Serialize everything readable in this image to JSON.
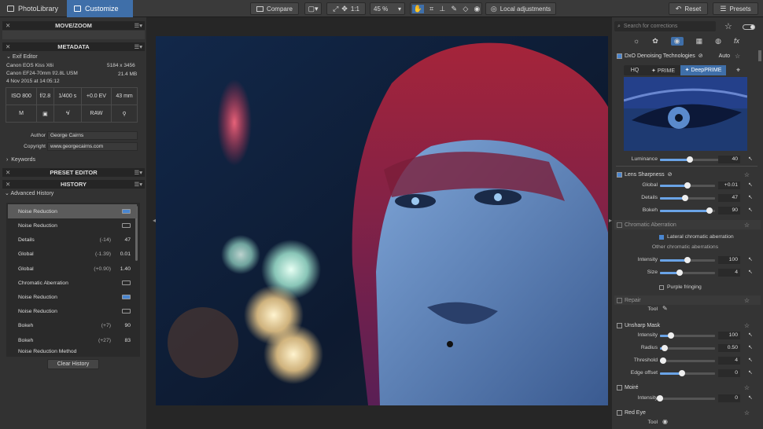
{
  "top": {
    "photolibrary": "PhotoLibrary",
    "customize": "Customize",
    "compare": "Compare",
    "ratio": "1:1",
    "zoom": "45 %",
    "local": "Local adjustments",
    "reset": "Reset",
    "presets": "Presets"
  },
  "left": {
    "move_zoom": "MOVE/ZOOM",
    "metadata": "METADATA",
    "exif_editor": "Exif Editor",
    "camera": "Canon EOS Kiss X6i",
    "dims": "5184 x 3456",
    "lens": "Canon EF24-70mm f/2.8L USM",
    "size": "21.4 MB",
    "date": "4 Nov 2015 at 14:05:12",
    "exif_cells": [
      "ISO 800",
      "f/2.8",
      "1/400 s",
      "+0.0 EV",
      "43 mm"
    ],
    "exif_icons": [
      "M",
      "RAW"
    ],
    "author_label": "Author",
    "author": "George Cairns",
    "copyright_label": "Copyright",
    "copyright": "www.georgecairns.com",
    "keywords": "Keywords",
    "preset_editor": "PRESET EDITOR",
    "history": "HISTORY",
    "advanced_history": "Advanced History",
    "history_rows": [
      {
        "label": "Noise Reduction",
        "prev": "",
        "val": ""
      },
      {
        "label": "Noise Reduction",
        "prev": "",
        "val": ""
      },
      {
        "label": "Details",
        "prev": "(-14)",
        "val": "47"
      },
      {
        "label": "Global",
        "prev": "(-1.39)",
        "val": "0.01"
      },
      {
        "label": "Global",
        "prev": "(+0.90)",
        "val": "1.40"
      },
      {
        "label": "Chromatic Aberration",
        "prev": "",
        "val": ""
      },
      {
        "label": "Noise Reduction",
        "prev": "",
        "val": ""
      },
      {
        "label": "Noise Reduction",
        "prev": "",
        "val": ""
      },
      {
        "label": "Bokeh",
        "prev": "(+7)",
        "val": "90"
      },
      {
        "label": "Bokeh",
        "prev": "(+27)",
        "val": "83"
      },
      {
        "label": "Noise Reduction Method",
        "prev": "",
        "val": ""
      }
    ],
    "clear_history": "Clear History"
  },
  "right": {
    "search_placeholder": "Search for corrections",
    "dxo_denoise": "DxO Denoising Technologies",
    "auto": "Auto",
    "hq": "HQ",
    "prime": "PRIME",
    "deepprime": "DeepPRIME",
    "luminance": "Luminance",
    "luminance_val": "40",
    "lens_sharpness": "Lens Sharpness",
    "global": "Global",
    "global_val": "+0.01",
    "details": "Details",
    "details_val": "47",
    "bokeh": "Bokeh",
    "bokeh_val": "90",
    "chromatic": "Chromatic Aberration",
    "lateral": "Lateral chromatic aberration",
    "other_ca": "Other chromatic aberrations",
    "intensity": "Intensity",
    "ca_intensity_val": "100",
    "size": "Size",
    "size_val": "4",
    "purple": "Purple fringing",
    "repair": "Repair",
    "tool": "Tool",
    "unsharp": "Unsharp Mask",
    "um_intensity_val": "100",
    "radius": "Radius",
    "radius_val": "0.50",
    "threshold": "Threshold",
    "threshold_val": "4",
    "edge_offset": "Edge offset",
    "edge_val": "0",
    "moire": "Moiré",
    "moire_val": "0",
    "red_eye": "Red Eye"
  },
  "levels": {
    "luminance": 0.45,
    "global": 0.5,
    "details": 0.45,
    "bokeh": 0.9,
    "ca_intensity": 0.5,
    "size": 0.35,
    "um_intensity": 0.2,
    "radius": 0.08,
    "threshold": 0.05,
    "edge": 0.4,
    "moire": 0.0
  }
}
